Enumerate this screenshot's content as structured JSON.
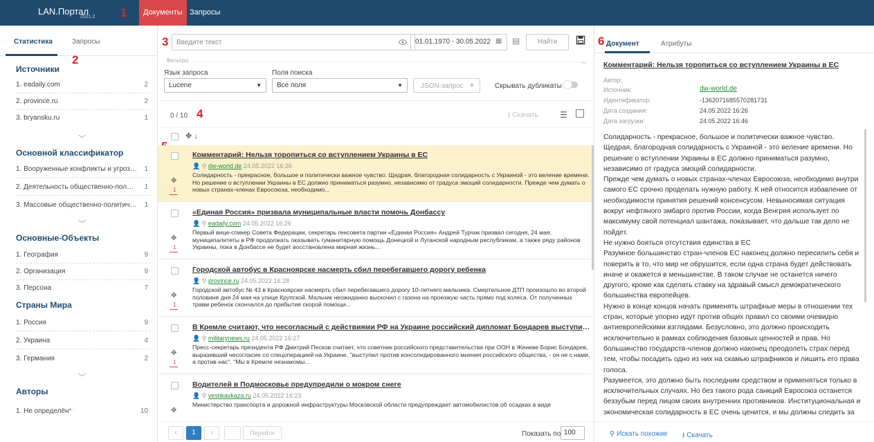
{
  "app": {
    "title": "LAN.Портал",
    "version": "2021.2"
  },
  "markers": [
    "1",
    "2",
    "3",
    "4",
    "5",
    "6"
  ],
  "top_tabs": [
    {
      "label": "Документы",
      "active": true
    },
    {
      "label": "Запросы",
      "active": false
    }
  ],
  "left": {
    "tabs": [
      {
        "label": "Статистика",
        "active": true
      },
      {
        "label": "Запросы",
        "active": false
      }
    ],
    "groups": [
      {
        "title": "Источники",
        "items": [
          {
            "label": "1. eadaily.com",
            "count": "2"
          },
          {
            "label": "2. province.ru",
            "count": "2"
          },
          {
            "label": "3. bryansku.ru",
            "count": "1"
          }
        ]
      },
      {
        "title": "Основной классификатор",
        "items": [
          {
            "label": "1. Вооруженные конфликты и угрозы их ...",
            "count": "1"
          },
          {
            "label": "2. Деятельность общественно-политичес...",
            "count": "1"
          },
          {
            "label": "3. Массовые общественно-политически...",
            "count": "1"
          }
        ]
      },
      {
        "title": "Основные-Объекты",
        "items": [
          {
            "label": "1. География",
            "count": "9"
          },
          {
            "label": "2. Организация",
            "count": "9"
          },
          {
            "label": "3. Персона",
            "count": "7"
          }
        ]
      },
      {
        "title": "Страны Мира",
        "items": [
          {
            "label": "1. Россия",
            "count": "9"
          },
          {
            "label": "2. Украина",
            "count": "4"
          },
          {
            "label": "3. Германия",
            "count": "2"
          }
        ]
      },
      {
        "title": "Авторы",
        "items": [
          {
            "label": "1. Не определён",
            "count": "10",
            "star": "*"
          }
        ]
      }
    ]
  },
  "search": {
    "placeholder": "Введите текст",
    "date_range": "01.01.1970  -  30.05.2022",
    "find_label": "Найти"
  },
  "filters": {
    "label": "Фильтры",
    "query_lang_label": "Язык запроса",
    "query_lang_value": "Lucene",
    "search_fields_label": "Поля поиска",
    "search_fields_value": "Все поля",
    "json_label": "JSON-запрос",
    "hide_dup_label": "Скрывать дубликаты"
  },
  "results": {
    "count": "0 / 10",
    "download_label": "Скачать"
  },
  "documents": [
    {
      "title": "Комментарий: Нельзя торопиться со вступлением Украины в ЕС",
      "source": "dw-world.de",
      "date": "24.05.2022 16:26",
      "text": "Солидарность - прекрасное, большое и политически важное чувство. Щедрая, благородная солидарность с Украиной - это веление времени. Но решение о вступлении Украины в ЕС должно приниматься разумно, независимо от градуса эмоций солидарности. Прежде чем думать о новых странах-членах Евросоюза, необходимо...",
      "num": "1",
      "selected": true
    },
    {
      "title": "«Единая Россия» призвала муниципальные власти помочь Донбассу",
      "source": "eadaily.com",
      "date": "24.05.2022 16:26",
      "text": "Первый вице-спикер Совета Федерации, секретарь генсовета партии «Единая Россия» Андрей Турчак призвал сегодня, 24 мая, муниципалитеты в РФ продолжать оказывать гуманитарную помощь Донецкой и Луганской народным республикам, а также ряду районов Украины, пока в Донбассе не будет восстановлена мирная жизнь...",
      "num": "1",
      "selected": false
    },
    {
      "title": "Городской автобус в Красноярске насмерть сбил перебегавшего дорогу ребенка",
      "source": "province.ru",
      "date": "24.05.2022 16:28",
      "text": "Городской автобус № 43 в Красноярске насмерть сбил перебегавшего дорогу 10-летнего мальчика. Смертельное ДТП произошло во второй половине дня 24 мая на улице Крупской. Мальчик неожиданно выскочил с газона на проезжую часть прямо под колеса. От полученных травм ребенок скончался до прибытия скорой помощи...",
      "num": "1",
      "selected": false
    },
    {
      "title": "В Кремле считают, что несогласный с действиями РФ на Украине российский дипломат Бондарев выступил п...",
      "source": "militarynews.ru",
      "date": "24.05.2022 16:27",
      "text": "Пресс-секретарь президента РФ Дмитрий Песков считает, что советник российского представительства при ООН в Женеве Борис Бондарев, выразивший несогласие со спецоперацией на Украине, \"выступил против консолидированного мнения российского общества, - он не с нами, а против нас\". \"Мы в Кремле незнакомы...",
      "num": "1",
      "selected": false
    },
    {
      "title": "Водителей в Подмосковье предупредили о мокром снеге",
      "source": "vestikavkaza.ru",
      "date": "24.05.2022 16:23",
      "text": "Министерство транспорта и дорожной инфраструктуры Московской области предупреждает автомобилистов об осадках в виде",
      "num": "",
      "selected": false
    }
  ],
  "pager": {
    "prev": "‹",
    "current": "1",
    "next": "›",
    "goto_label": "Перейти",
    "show_label": "Показать по",
    "per_page": "100"
  },
  "right": {
    "tabs": [
      {
        "label": "Документ",
        "active": true
      },
      {
        "label": "Атрибуты",
        "active": false
      }
    ],
    "title": "Комментарий: Нельзя торопиться со вступлением Украины в ЕС",
    "attrs": [
      {
        "label": "Автор:",
        "value": ""
      },
      {
        "label": "Источник:",
        "value": "dw-world.de",
        "link": true
      },
      {
        "label": "Идентификатор:",
        "value": "-1362071685570281731"
      },
      {
        "label": "Дата создания:",
        "value": "24.05.2022 16:26"
      },
      {
        "label": "Дата загрузки:",
        "value": "24.05.2022 16:46"
      }
    ],
    "body": [
      "Солидарность - прекрасное, большое и политически важное чувство. Щедрая, благородная солидарность с Украиной - это веление времени. Но решение о вступлении Украины в ЕС должно приниматься разумно, независимо от градуса эмоций солидарности.",
      "Прежде чем думать о новых странах-членах Евросоюза, необходимо внутри самого ЕС срочно проделать нужную работу. К ней относится избавление от необходимости принятия решений консенсусом. Невыносимая ситуация вокруг нефтяного эмбарго против России, когда Венгрия использует по максимуму свой потенциал шантажа, показывает, что дальше так дело не пойдет.",
      "Не нужно бояться отсутствия единства в ЕС",
      "Разумное большинство стран-членов ЕС наконец должно пересилить себя и поверить в то, что мир не обрушится, если одна страна будет действовать иначе и окажется в меньшинстве. В таком случае не останется ничего другого, кроме как сделать ставку на здравый смысл демократического большинства европейцев.",
      "Нужно в конце концов начать применять штрафные меры в отношении тех стран, которые упорно идут против общих правил со своими очевидно антиевропейскими взглядами. Безусловно, это должно происходить исключительно в рамках соблюдения базовых ценностей и прав. Но большинство государств-членов должно наконец преодолеть страх перед тем, чтобы посадить одно из них на скамью штрафников и лишить его права голоса.",
      "Разумеется, это должно быть последним средством и применяться только в исключительных случаях. Но без такого рода санкций Евросоюз останется беззубым перед лицом своих внутренних противников. Институциональная и экономическая солидарность в ЕС очень ценится, и мы должны следить за тем, чтобы она не использовалась против большинства теми странами,"
    ],
    "find_similar": "Искать похожие",
    "download": "Скачать"
  },
  "colors": {
    "topbar": "#1f4a6e",
    "accent_red": "#d9474a",
    "link_green": "#2a8a3a",
    "selected_row": "#fbf1cd",
    "pager_active": "#2f7ec2"
  }
}
